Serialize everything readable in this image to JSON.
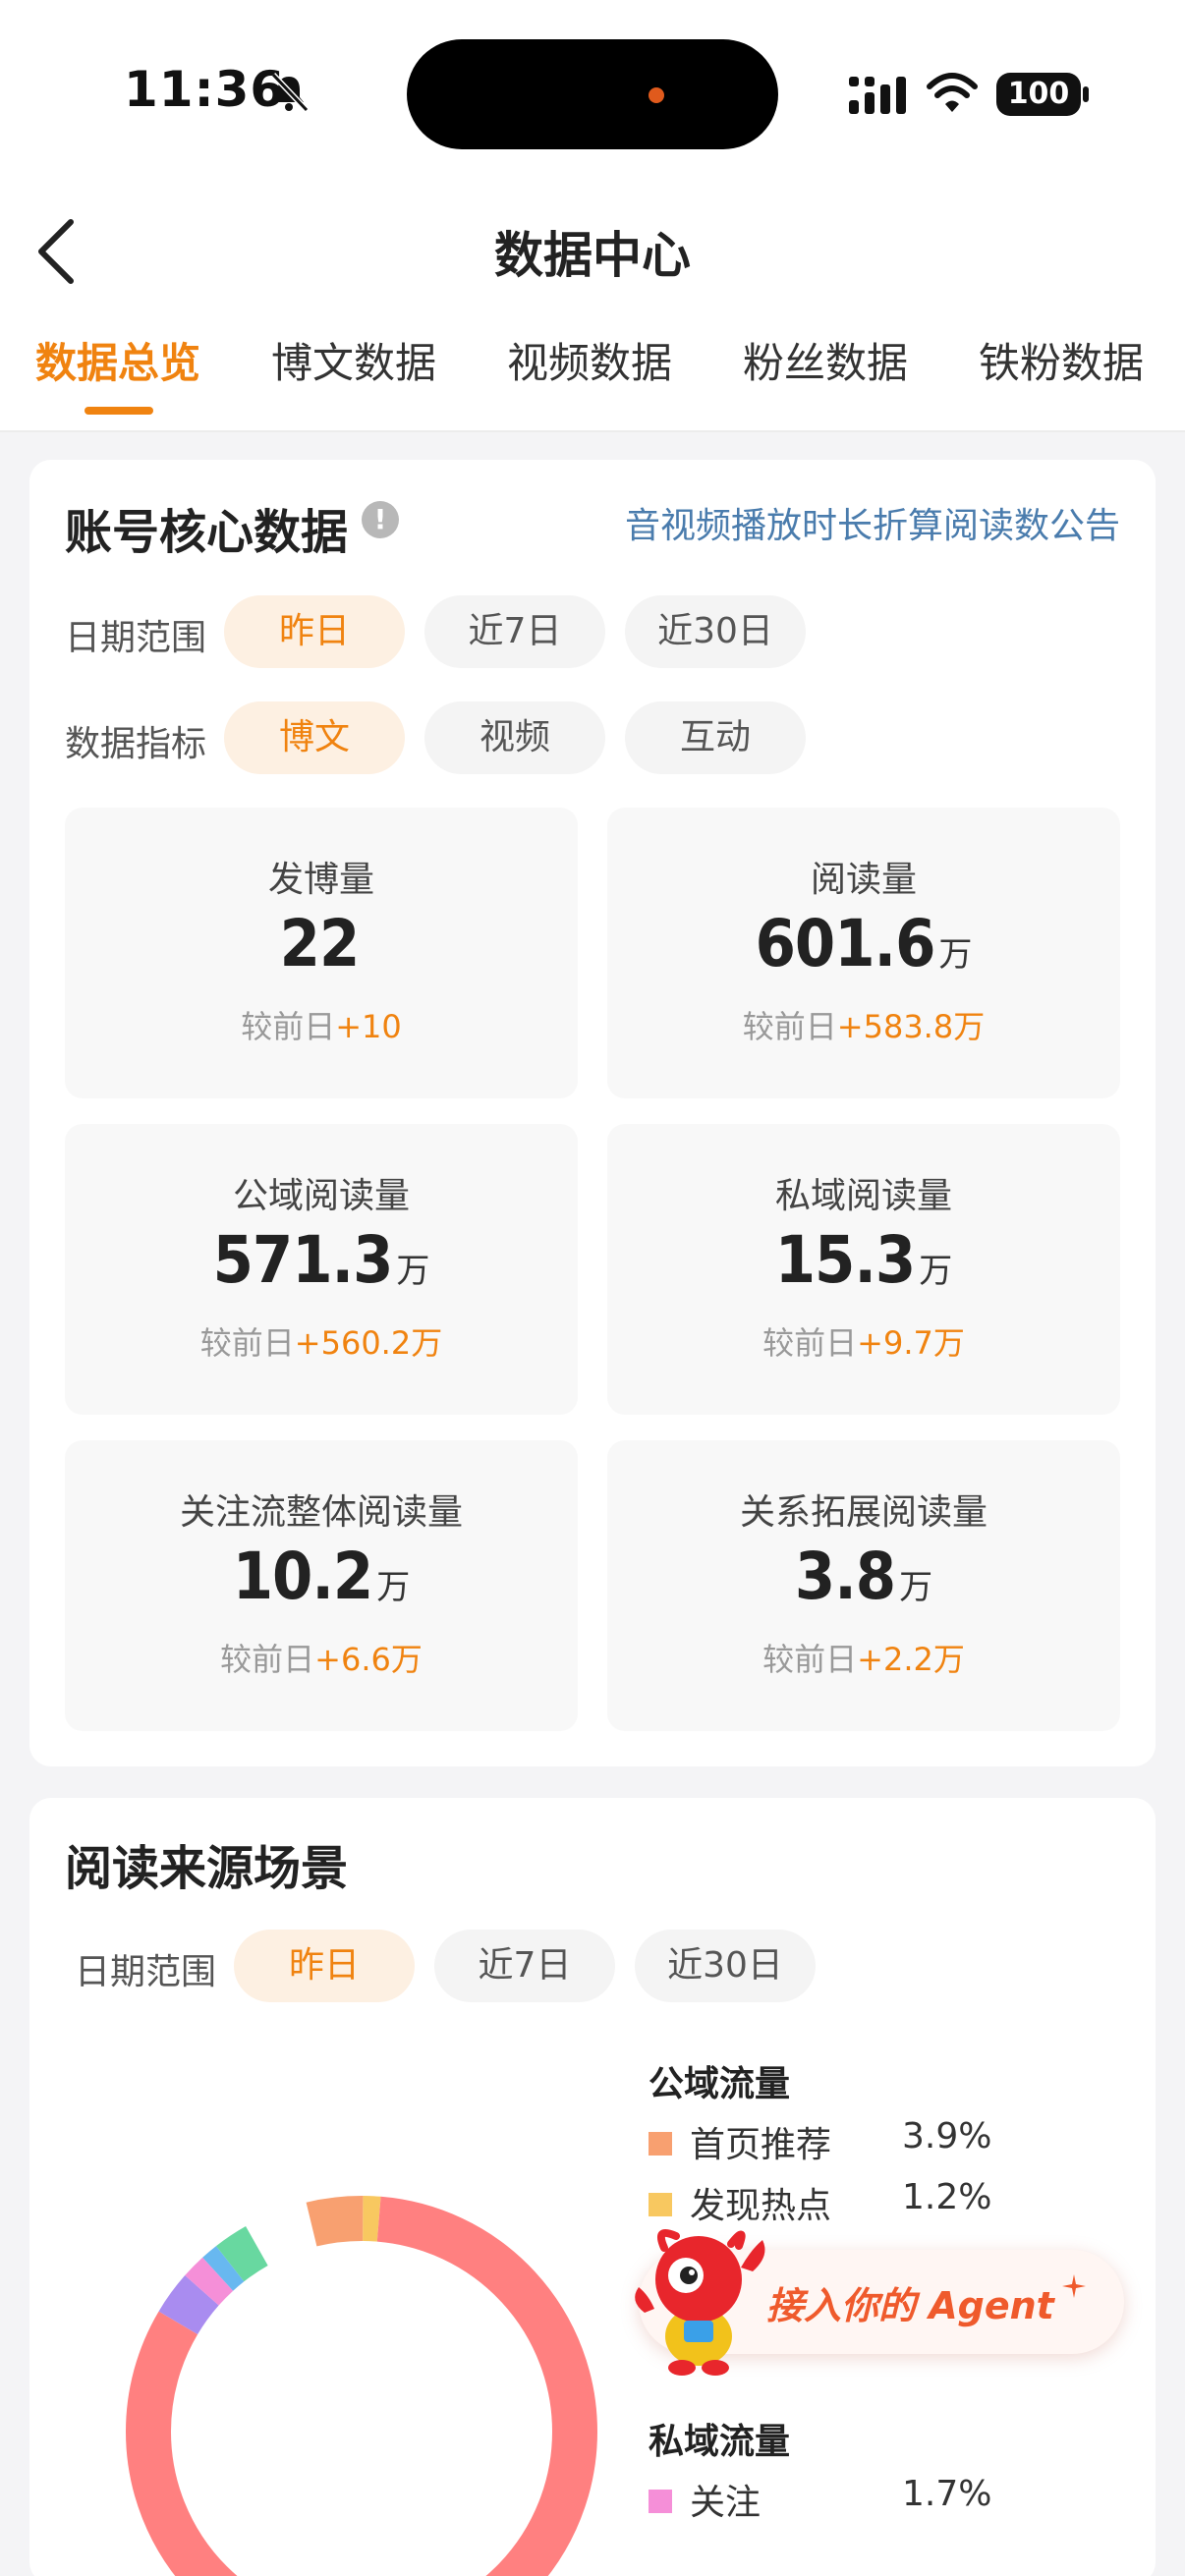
{
  "status_bar": {
    "time": "11:36",
    "battery": "100"
  },
  "header": {
    "title": "数据中心"
  },
  "tabs": [
    {
      "label": "数据总览",
      "active": true
    },
    {
      "label": "博文数据"
    },
    {
      "label": "视频数据"
    },
    {
      "label": "粉丝数据"
    },
    {
      "label": "铁粉数据"
    }
  ],
  "core": {
    "title": "账号核心数据",
    "info_icon": "!",
    "notice_link": "音视频播放时长折算阅读数公告",
    "date_label": "日期范围",
    "date_options": [
      "昨日",
      "近7日",
      "近30日"
    ],
    "date_selected": "昨日",
    "metric_label": "数据指标",
    "metric_options": [
      "博文",
      "视频",
      "互动"
    ],
    "metric_selected": "博文",
    "compare_prefix": "较前日",
    "stats": [
      {
        "label": "发博量",
        "value": "22",
        "unit": "",
        "delta": "+10"
      },
      {
        "label": "阅读量",
        "value": "601.6",
        "unit": "万",
        "delta": "+583.8万"
      },
      {
        "label": "公域阅读量",
        "value": "571.3",
        "unit": "万",
        "delta": "+560.2万"
      },
      {
        "label": "私域阅读量",
        "value": "15.3",
        "unit": "万",
        "delta": "+9.7万"
      },
      {
        "label": "关注流整体阅读量",
        "value": "10.2",
        "unit": "万",
        "delta": "+6.6万"
      },
      {
        "label": "关系拓展阅读量",
        "value": "3.8",
        "unit": "万",
        "delta": "+2.2万"
      }
    ]
  },
  "source": {
    "title": "阅读来源场景",
    "date_label": "日期范围",
    "date_options": [
      "昨日",
      "近7日",
      "近30日"
    ],
    "date_selected": "昨日",
    "public_title": "公域流量",
    "public_items": [
      {
        "name": "首页推荐",
        "pct": "3.9%",
        "color": "#f8a070"
      },
      {
        "name": "发现热点",
        "pct": "1.2%",
        "color": "#f8c860"
      }
    ],
    "private_title": "私域流量",
    "private_items": [
      {
        "name": "关注",
        "pct": "1.7%",
        "color": "#f58fd8"
      }
    ],
    "donut_segments": [
      {
        "color": "#f8a070",
        "fraction": 0.039
      },
      {
        "color": "#f8c860",
        "fraction": 0.012
      },
      {
        "color": "#ff8080",
        "fraction": 0.822
      },
      {
        "color": "#a98cf0",
        "fraction": 0.03
      },
      {
        "color": "#f58fd8",
        "fraction": 0.017
      },
      {
        "color": "#68b8f0",
        "fraction": 0.012
      },
      {
        "color": "#68d8a0",
        "fraction": 0.024
      }
    ]
  },
  "agent_banner": {
    "label": "接入你的 Agent"
  },
  "colors": {
    "accent": "#f08310",
    "link": "#4a7cad",
    "agent": "#ef5a2c"
  }
}
